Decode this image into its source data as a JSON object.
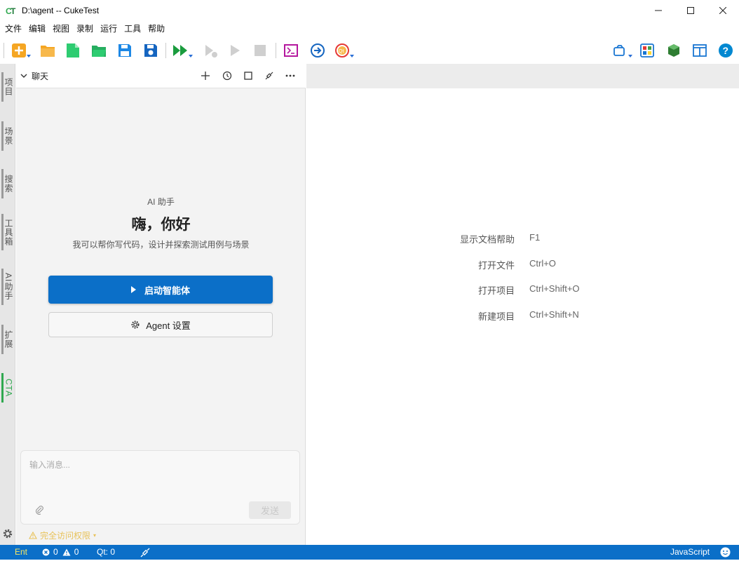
{
  "window": {
    "title": "D:\\agent -- CukeTest"
  },
  "menu": [
    "文件",
    "编辑",
    "视图",
    "录制",
    "运行",
    "工具",
    "帮助"
  ],
  "side_tabs": [
    "项目",
    "场景",
    "搜索",
    "工具箱",
    "AI助手",
    "扩展",
    "CTA"
  ],
  "chat_panel": {
    "header_label": "聊天",
    "ai_label": "AI 助手",
    "greeting": "嗨，你好",
    "description": "我可以帮你写代码，设计并探索测试用例与场景",
    "start_button": "启动智能体",
    "settings_button": "Agent 设置",
    "input_placeholder": "输入消息...",
    "send_button": "发送",
    "permission": "完全访问权限"
  },
  "shortcuts": [
    {
      "label": "显示文档帮助",
      "key": "F1"
    },
    {
      "label": "打开文件",
      "key": "Ctrl+O"
    },
    {
      "label": "打开项目",
      "key": "Ctrl+Shift+O"
    },
    {
      "label": "新建项目",
      "key": "Ctrl+Shift+N"
    }
  ],
  "statusbar": {
    "ent": "Ent",
    "errors": "0",
    "warnings": "0",
    "qt": "Qt: 0",
    "language": "JavaScript"
  },
  "colors": {
    "accent_blue": "#0b6fc8",
    "active_tab_green": "#2fa84f",
    "warning_yellow": "#e8c25a",
    "status_ent_yellow": "#f5e663"
  },
  "icons": {
    "toolbar": [
      "new-icon",
      "open-folder-icon",
      "new-file-icon",
      "open-file-icon",
      "save-icon",
      "save-all-icon",
      "run-all-icon",
      "run-debug-icon",
      "run-icon",
      "stop-icon",
      "terminal-icon",
      "navigate-icon",
      "qt-icon",
      "camera-icon",
      "layout-grid-icon",
      "cube-icon",
      "panel-layout-icon",
      "help-icon"
    ]
  }
}
